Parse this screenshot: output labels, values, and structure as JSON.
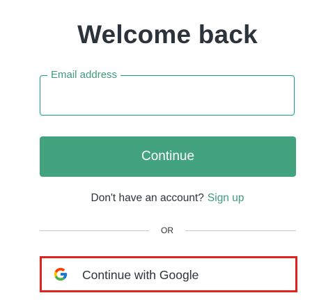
{
  "page": {
    "title": "Welcome back"
  },
  "email": {
    "label": "Email address",
    "value": "",
    "placeholder": ""
  },
  "continue_button": {
    "label": "Continue"
  },
  "signup": {
    "prompt": "Don't have an account?",
    "link": "Sign up"
  },
  "divider": {
    "text": "OR"
  },
  "google_button": {
    "label": "Continue with Google",
    "icon": "google-icon",
    "highlighted": true
  },
  "colors": {
    "accent": "#10a37f",
    "button_bg": "#43a37f",
    "link": "#3f9a7a",
    "highlight_border": "#e0231f",
    "text": "#2d333a"
  }
}
